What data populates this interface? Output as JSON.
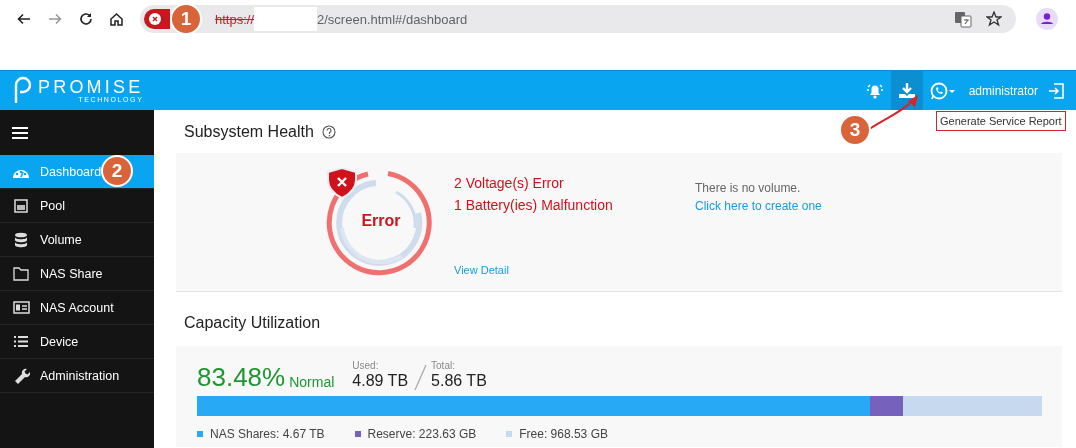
{
  "browser": {
    "insecure": true,
    "url_scheme": "https://",
    "url_rest": "2/screen.html#/dashboard"
  },
  "header": {
    "brand": "PROMISE",
    "brand_sub": "TECHNOLOGY",
    "buttons": [
      {
        "kind": "bell",
        "highlighted": false
      },
      {
        "kind": "download",
        "highlighted": true
      },
      {
        "kind": "chat",
        "highlighted": false
      }
    ],
    "user": "administrator",
    "tooltip": "Generate Service Report",
    "tooltip_outlined": true
  },
  "sidebar": {
    "items": [
      {
        "label": "Dashboard",
        "selected": true
      },
      {
        "label": "Pool",
        "selected": false
      },
      {
        "label": "Volume",
        "selected": false
      },
      {
        "label": "NAS Share",
        "selected": false
      },
      {
        "label": "NAS Account",
        "selected": false
      },
      {
        "label": "Device",
        "selected": false
      },
      {
        "label": "Administration",
        "selected": false
      }
    ]
  },
  "health": {
    "title": "Subsystem Health",
    "status": "Error",
    "kind": "error",
    "messages": [
      "2 Voltage(s) Error",
      "1 Battery(ies) Malfunction"
    ],
    "view_detail": "View Detail",
    "volume_note": "There is no volume.",
    "volume_link": "Click here to create one"
  },
  "capacity": {
    "title": "Capacity Utilization",
    "percent": "83.48%",
    "state": "Normal",
    "used_label": "Used:",
    "used": "4.89 TB",
    "total_label": "Total:",
    "total": "5.86 TB",
    "usage_bar": {
      "level": 0.835,
      "nas_part": {
        "level": 0.796
      }
    },
    "segments": [
      {
        "label": "NAS Shares: 4.67 TB",
        "color": "#27a9f5"
      },
      {
        "label": "Reserve: 223.63 GB",
        "color": "#7661bd"
      },
      {
        "label": "Free: 968.53 GB",
        "color": "#c6d9ef"
      }
    ]
  },
  "callouts": [
    {
      "label": "1"
    },
    {
      "label": "2"
    },
    {
      "label": "3"
    }
  ]
}
